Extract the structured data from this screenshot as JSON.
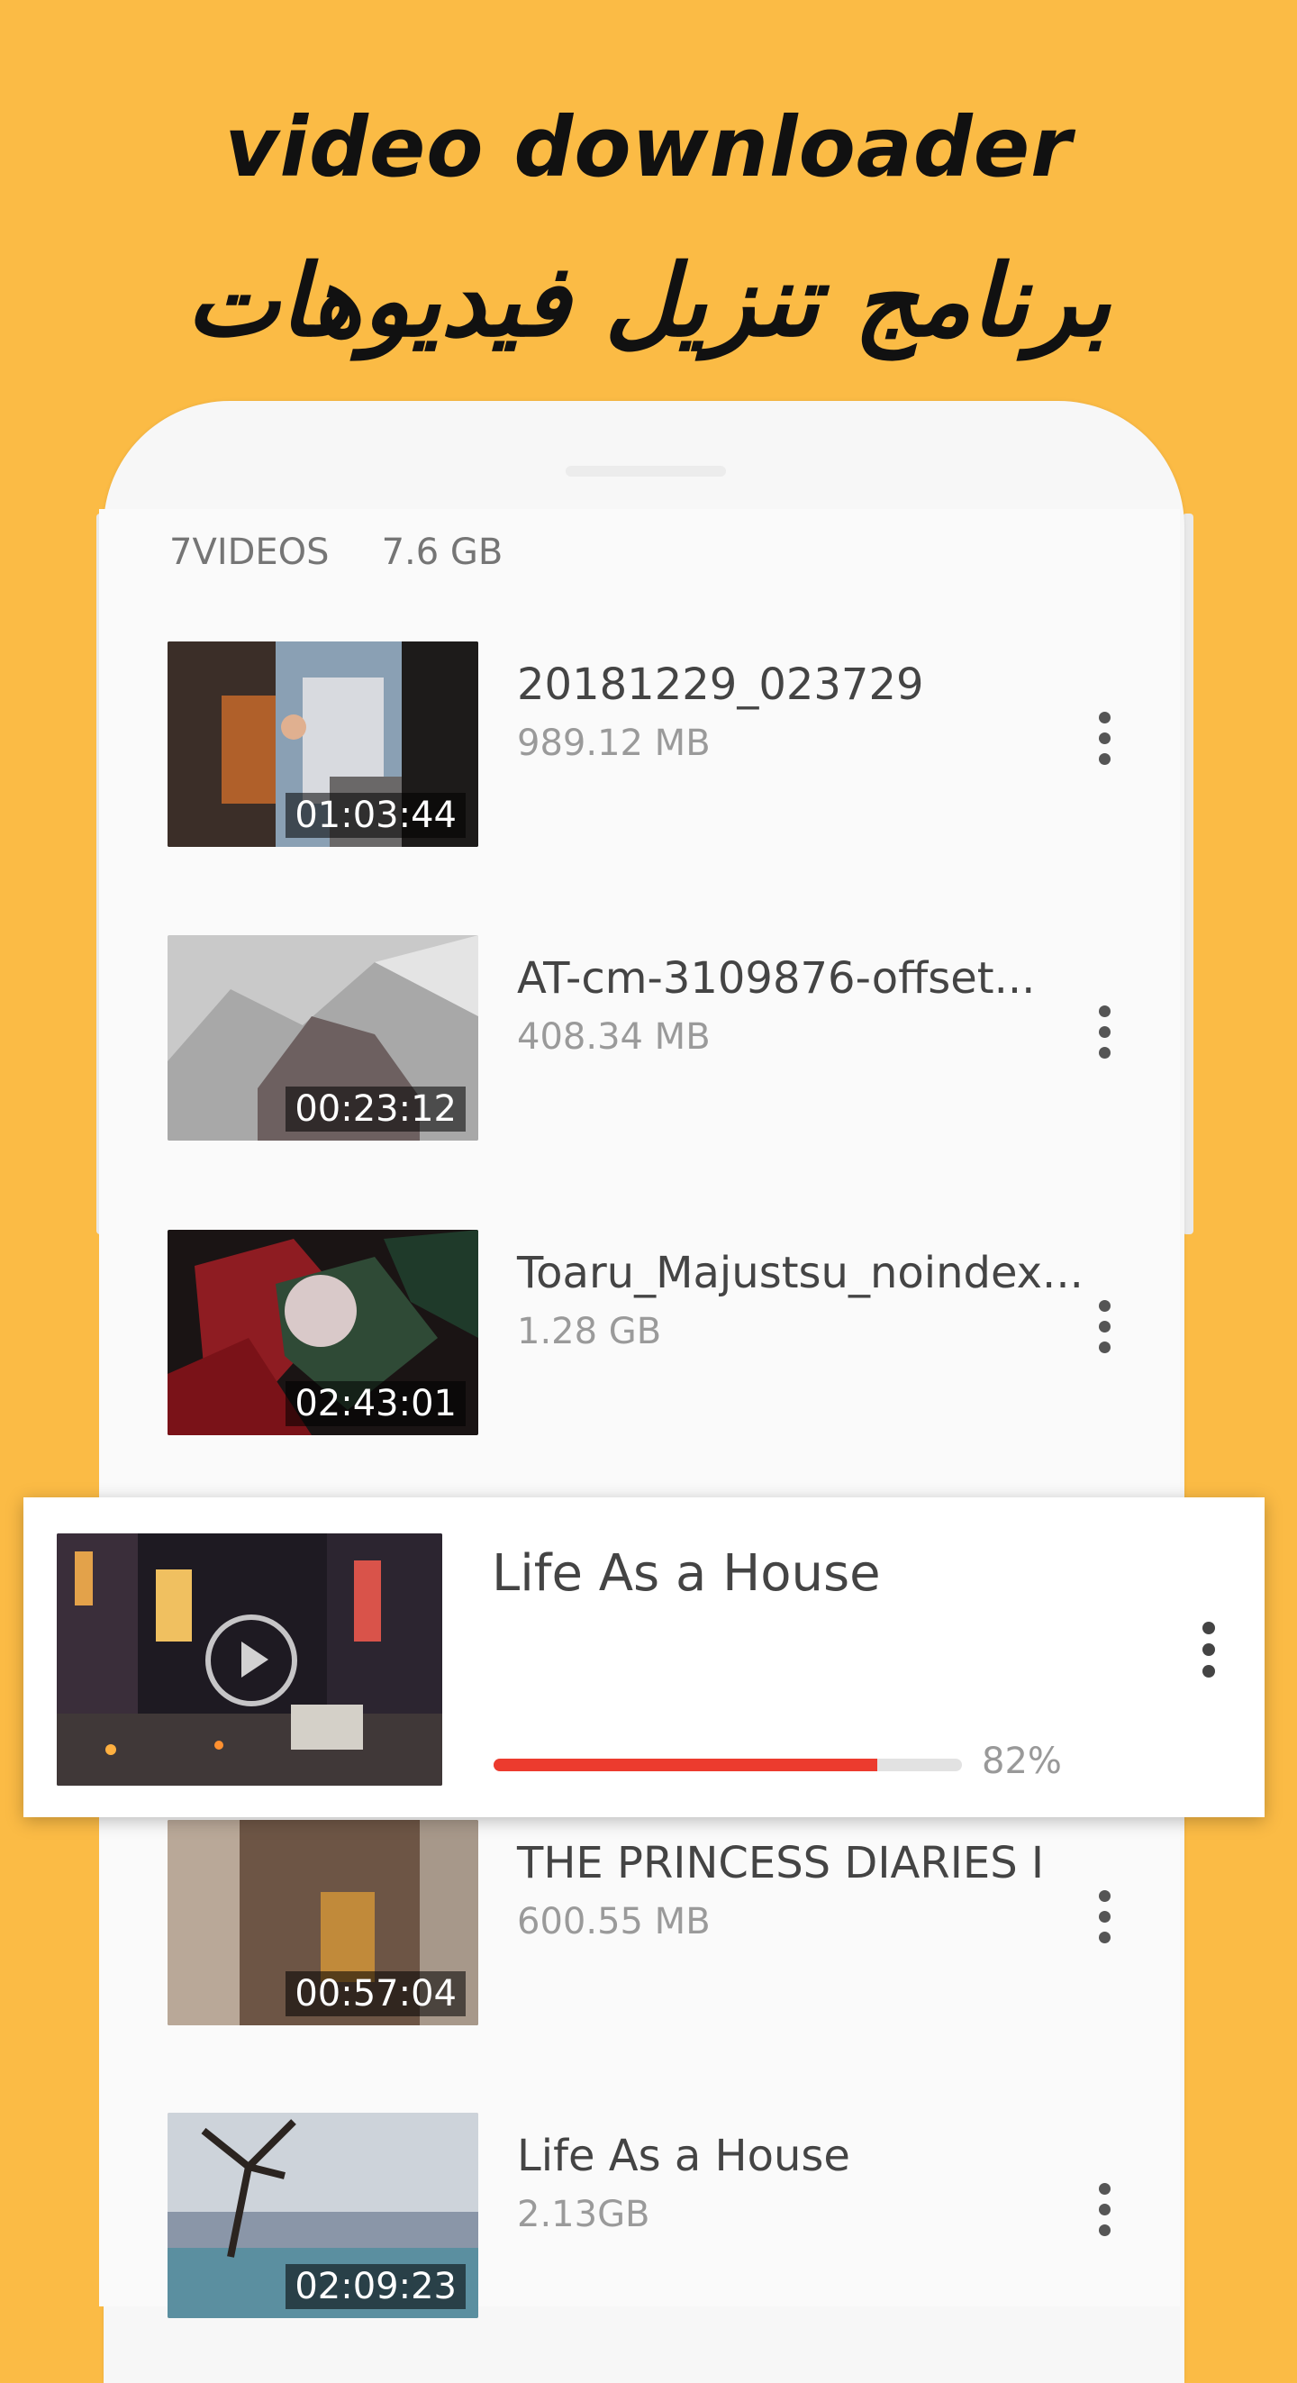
{
  "promo": {
    "title": "video downloader",
    "subtitle": "برنامج تنزيل فيديوهات"
  },
  "summary": {
    "count": "7VIDEOS",
    "size": "7.6 GB"
  },
  "videos": [
    {
      "title": "20181229_023729",
      "size": "989.12 MB",
      "duration": "01:03:44"
    },
    {
      "title": "AT-cm-3109876-offset...",
      "size": "408.34 MB",
      "duration": "00:23:12"
    },
    {
      "title": "Toaru_Majustsu_noindex...",
      "size": "1.28 GB",
      "duration": "02:43:01"
    },
    {
      "title": "THE PRINCESS DIARIES I",
      "size": "600.55 MB",
      "duration": "00:57:04"
    },
    {
      "title": "Life As a House",
      "size": "2.13GB",
      "duration": "02:09:23"
    }
  ],
  "downloading": {
    "title": "Life As a House",
    "progress_text": "82%",
    "progress": 0.82
  },
  "colors": {
    "background": "#FBBB45",
    "accent": "#EC3B2E"
  }
}
